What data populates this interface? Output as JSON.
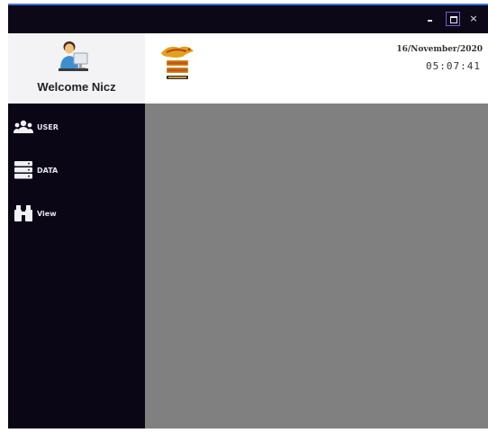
{
  "window": {
    "controls": {
      "minimize": "-",
      "maximize": "",
      "close": "×"
    }
  },
  "header": {
    "welcome": "Welcome Nicz",
    "date": "16/November/2020",
    "time": "05:07:41",
    "avatar_icon": "user-at-computer-icon",
    "logo_icon": "golden-dragon-logo-icon"
  },
  "sidebar": {
    "items": [
      {
        "label": "USER",
        "icon": "users-icon"
      },
      {
        "label": "DATA",
        "icon": "database-icon"
      },
      {
        "label": "View",
        "icon": "binoculars-icon"
      }
    ]
  },
  "colors": {
    "titlebar": "#0c0818",
    "sidebar": "#0a0615",
    "content": "#808080",
    "accent_border": "#3a6fd8"
  }
}
